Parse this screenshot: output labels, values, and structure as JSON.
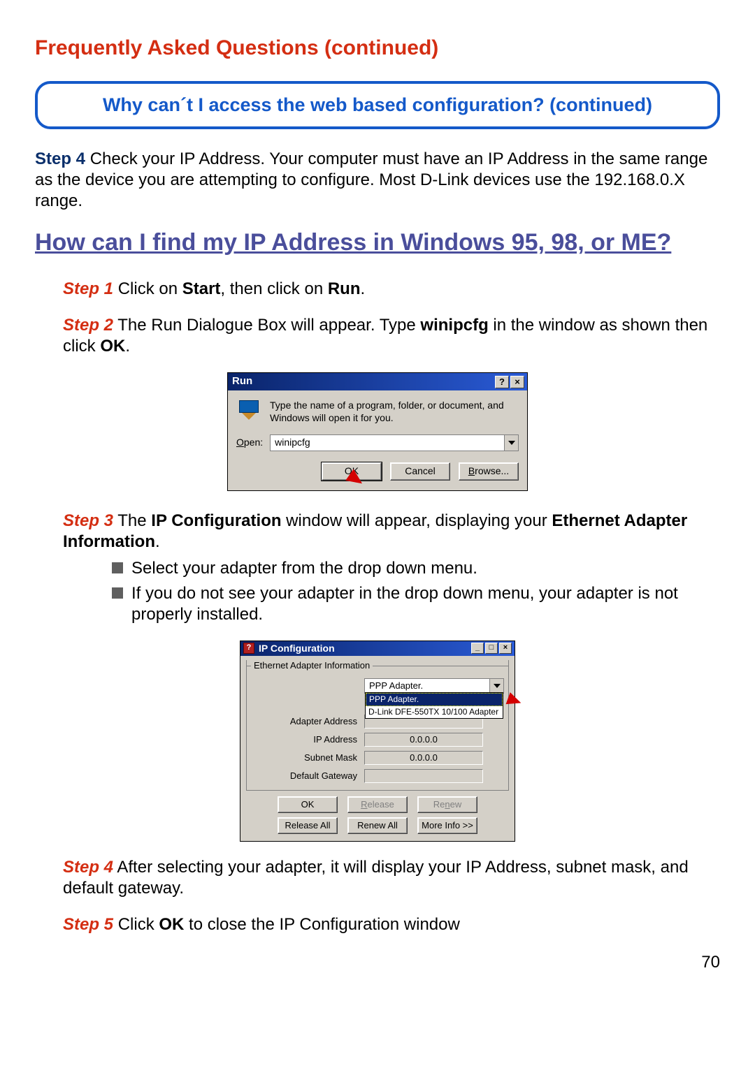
{
  "page_title": "Frequently Asked Questions (continued)",
  "callout_text": "Why can´t I access the web based configuration? (continued)",
  "intro": {
    "step_label": "Step 4",
    "text_after": " Check your IP Address. Your computer must have an IP Address in the same range as the device you are attempting to configure. Most D-Link devices use the 192.168.0.X range."
  },
  "question_heading": "How can I find my IP Address in Windows 95, 98, or ME?",
  "step1": {
    "label": "Step 1",
    "pre": " Click on ",
    "bold1": "Start",
    "mid": ", then click on ",
    "bold2": "Run",
    "post": "."
  },
  "step2": {
    "label": "Step 2",
    "pre": " The Run Dialogue Box will appear. Type ",
    "bold1": "winipcfg",
    "mid": " in the window as shown then click ",
    "bold2": "OK",
    "post": "."
  },
  "run_dialog": {
    "title": "Run",
    "help_btn": "?",
    "close_btn": "×",
    "description": "Type the name of a program, folder, or document, and Windows will open it for you.",
    "open_label_u": "O",
    "open_label_rest": "pen:",
    "value": "winipcfg",
    "ok": "OK",
    "cancel": "Cancel",
    "browse_u": "B",
    "browse_rest": "rowse..."
  },
  "step3": {
    "label": "Step 3",
    "pre": " The ",
    "bold1": "IP Configuration",
    "mid": " window will appear, displaying your ",
    "bold2": "Ethernet Adapter Information",
    "post": "."
  },
  "bullets": [
    "Select your adapter from the drop down menu.",
    "If you do not see your adapter in the drop down menu, your adapter is not properly installed."
  ],
  "ip_dialog": {
    "title": "IP Configuration",
    "icon_mark": "?",
    "min_btn": "_",
    "max_btn": "□",
    "close_btn": "×",
    "group_label": "Ethernet Adapter Information",
    "combo_value": "PPP Adapter.",
    "dropdown": [
      "PPP Adapter.",
      "D-Link DFE-550TX 10/100 Adapter"
    ],
    "labels": {
      "adapter_address": "Adapter Address",
      "ip_address": "IP Address",
      "subnet_mask": "Subnet Mask",
      "default_gateway": "Default Gateway"
    },
    "values": {
      "adapter_address": "",
      "ip_address": "0.0.0.0",
      "subnet_mask": "0.0.0.0",
      "default_gateway": ""
    },
    "buttons": {
      "ok": "OK",
      "release": "Release",
      "renew": "Renew",
      "release_all": "Release All",
      "renew_all": "Renew All",
      "more_info": "More Info >>"
    }
  },
  "step4": {
    "label": "Step 4",
    "text": "  After selecting your adapter, it will display your IP Address, subnet mask, and default gateway."
  },
  "step5": {
    "label": "Step 5",
    "pre": "  Click ",
    "bold1": "OK",
    "post": " to close the IP Configuration window"
  },
  "page_number": "70"
}
